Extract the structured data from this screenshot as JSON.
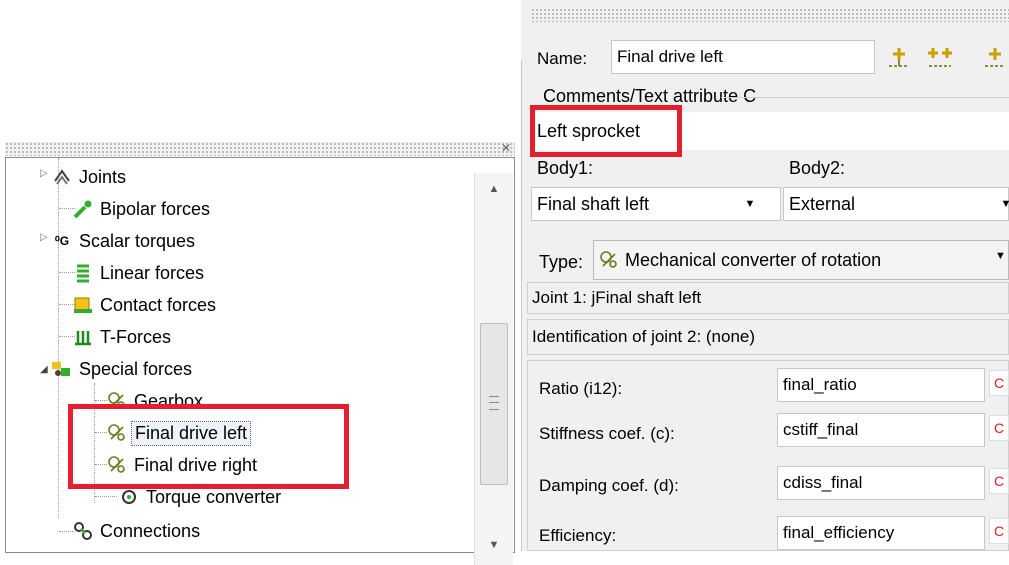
{
  "colors": {
    "highlight": "#e3202f",
    "panel_bg": "#f0f0f0",
    "c_button": "#d82020"
  },
  "tree": {
    "items": [
      {
        "label": "Joints",
        "icon": "joints-icon"
      },
      {
        "label": "Bipolar forces",
        "icon": "bipolar-force-icon"
      },
      {
        "label": "Scalar torques",
        "icon": "scalar-torque-icon"
      },
      {
        "label": "Linear forces",
        "icon": "linear-force-icon"
      },
      {
        "label": "Contact forces",
        "icon": "contact-force-icon"
      },
      {
        "label": "T-Forces",
        "icon": "t-force-icon"
      },
      {
        "label": "Special forces",
        "icon": "special-forces-icon"
      },
      {
        "label": "Gearbox",
        "icon": "gear-converter-icon"
      },
      {
        "label": "Final drive left",
        "icon": "gear-converter-icon"
      },
      {
        "label": "Final drive right",
        "icon": "gear-converter-icon"
      },
      {
        "label": "Torque converter",
        "icon": "torque-converter-icon"
      },
      {
        "label": "Connections",
        "icon": "connections-icon"
      }
    ]
  },
  "props": {
    "name_label": "Name:",
    "name_value": "Final drive left",
    "comments_label": "Comments/Text attribute C",
    "comments_value": "Left sprocket",
    "body1_label": "Body1:",
    "body1_value": "Final shaft left",
    "body2_label": "Body2:",
    "body2_value": "External",
    "type_label": "Type:",
    "type_value": "Mechanical converter of rotation",
    "joint1_text": "Joint 1: jFinal shaft left",
    "joint2_text": "Identification of joint 2: (none)",
    "params": [
      {
        "label": "Ratio (i12):",
        "value": "final_ratio"
      },
      {
        "label": "Stiffness coef. (c):",
        "value": "cstiff_final"
      },
      {
        "label": "Damping coef. (d):",
        "value": "cdiss_final"
      },
      {
        "label": "Efficiency:",
        "value": "final_efficiency"
      }
    ],
    "c_button_label": "C"
  }
}
